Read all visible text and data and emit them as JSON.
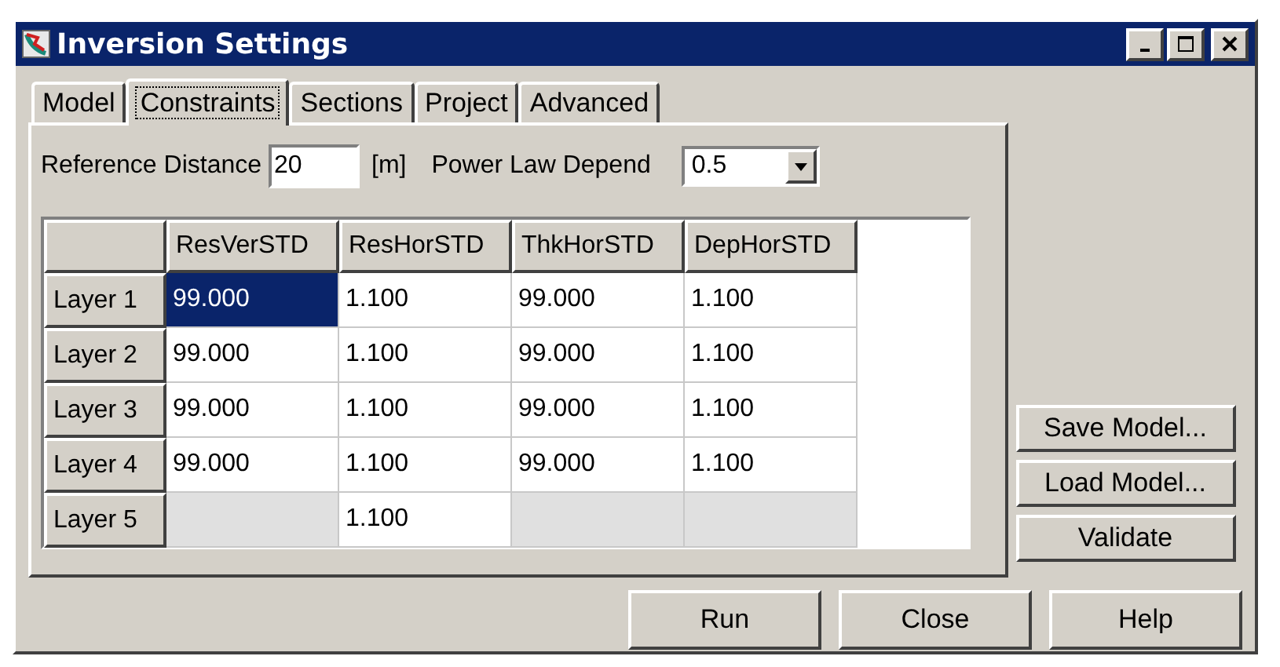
{
  "window": {
    "title": "Inversion Settings"
  },
  "tabs": [
    {
      "label": "Model",
      "selected": false
    },
    {
      "label": "Constraints",
      "selected": true
    },
    {
      "label": "Sections",
      "selected": false
    },
    {
      "label": "Project",
      "selected": false
    },
    {
      "label": "Advanced",
      "selected": false
    }
  ],
  "reference_distance": {
    "label": "Reference Distance",
    "value": "20",
    "unit": "[m]"
  },
  "power_law": {
    "label": "Power Law Depend",
    "value": "0.5"
  },
  "table": {
    "columns": [
      "ResVerSTD",
      "ResHorSTD",
      "ThkHorSTD",
      "DepHorSTD"
    ],
    "rows": [
      {
        "header": "Layer 1",
        "cells": [
          {
            "value": "99.000",
            "selected": true,
            "disabled": false
          },
          {
            "value": "1.100",
            "selected": false,
            "disabled": false
          },
          {
            "value": "99.000",
            "selected": false,
            "disabled": false
          },
          {
            "value": "1.100",
            "selected": false,
            "disabled": false
          }
        ]
      },
      {
        "header": "Layer 2",
        "cells": [
          {
            "value": "99.000",
            "selected": false,
            "disabled": false
          },
          {
            "value": "1.100",
            "selected": false,
            "disabled": false
          },
          {
            "value": "99.000",
            "selected": false,
            "disabled": false
          },
          {
            "value": "1.100",
            "selected": false,
            "disabled": false
          }
        ]
      },
      {
        "header": "Layer 3",
        "cells": [
          {
            "value": "99.000",
            "selected": false,
            "disabled": false
          },
          {
            "value": "1.100",
            "selected": false,
            "disabled": false
          },
          {
            "value": "99.000",
            "selected": false,
            "disabled": false
          },
          {
            "value": "1.100",
            "selected": false,
            "disabled": false
          }
        ]
      },
      {
        "header": "Layer 4",
        "cells": [
          {
            "value": "99.000",
            "selected": false,
            "disabled": false
          },
          {
            "value": "1.100",
            "selected": false,
            "disabled": false
          },
          {
            "value": "99.000",
            "selected": false,
            "disabled": false
          },
          {
            "value": "1.100",
            "selected": false,
            "disabled": false
          }
        ]
      },
      {
        "header": "Layer 5",
        "cells": [
          {
            "selected": false,
            "disabled": true
          },
          {
            "value": "1.100",
            "selected": false,
            "disabled": false
          },
          {
            "selected": false,
            "disabled": true
          },
          {
            "selected": false,
            "disabled": true
          }
        ]
      }
    ]
  },
  "side_buttons": [
    "Save Model...",
    "Load Model...",
    "Validate"
  ],
  "buttons": [
    "Run",
    "Close",
    "Help"
  ]
}
